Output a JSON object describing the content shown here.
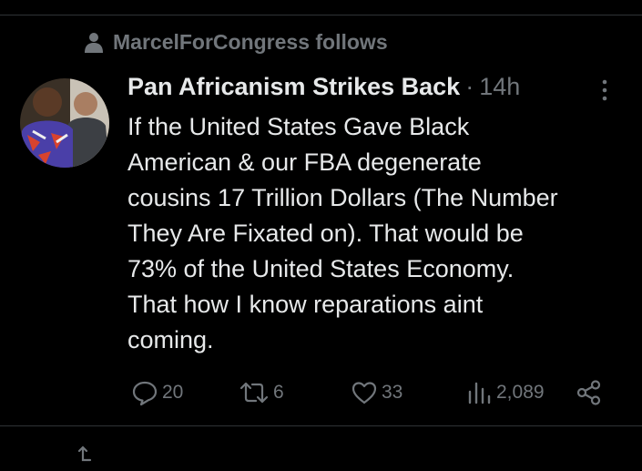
{
  "social_context": {
    "icon": "person-icon",
    "text": "MarcelForCongress follows"
  },
  "tweet": {
    "author_name": "Pan Africanism Strikes Back",
    "separator": "·",
    "timestamp": "14h",
    "lines": [
      "If the United States Gave Black",
      "American & our FBA degenerate",
      "cousins 17 Trillion Dollars (The Number",
      "They Are Fixated on). That would be",
      "73% of the United States Economy.",
      "That how I know reparations aint",
      "coming."
    ]
  },
  "actions": {
    "replies": "20",
    "retweets": "6",
    "likes": "33",
    "views": "2,089"
  },
  "colors": {
    "background": "#000000",
    "text": "#e7e9ea",
    "secondary": "#71767b",
    "divider": "#2f3336"
  }
}
